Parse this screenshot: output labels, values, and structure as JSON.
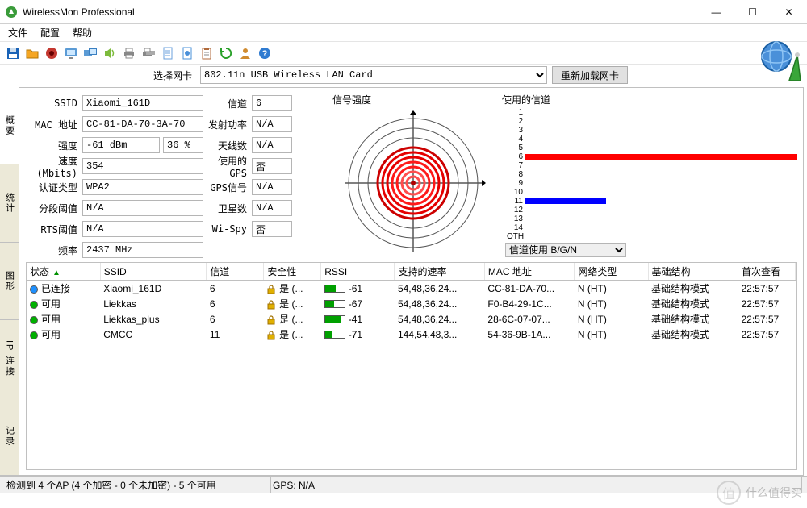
{
  "window": {
    "title": "WirelessMon Professional",
    "min": "—",
    "max": "☐",
    "close": "✕"
  },
  "menu": {
    "file": "文件",
    "config": "配置",
    "help": "帮助"
  },
  "selector": {
    "label": "选择网卡",
    "card": "802.11n USB Wireless LAN Card",
    "reload": "重新加载网卡"
  },
  "vtabs": [
    "概要",
    "统计",
    "图形",
    "IP 连接",
    "记录"
  ],
  "form": {
    "ssid_lbl": "SSID",
    "ssid": "Xiaomi_161D",
    "mac_lbl": "MAC 地址",
    "mac": "CC-81-DA-70-3A-70",
    "strength_lbl": "强度",
    "strength_dbm": "-61 dBm",
    "strength_pct": "36 %",
    "speed_lbl": "速度(Mbits)",
    "speed": "354",
    "auth_lbl": "认证类型",
    "auth": "WPA2",
    "frag_lbl": "分段阈值",
    "frag": "N/A",
    "rts_lbl": "RTS阈值",
    "rts": "N/A",
    "freq_lbl": "频率",
    "freq": "2437 MHz",
    "chan_lbl": "信道",
    "chan": "6",
    "txp_lbl": "发射功率",
    "txp": "N/A",
    "ant_lbl": "天线数",
    "ant": "N/A",
    "gps_lbl": "使用的GPS",
    "gps": "否",
    "gpssig_lbl": "GPS信号",
    "gpssig": "N/A",
    "sat_lbl": "卫星数",
    "sat": "N/A",
    "wispy_lbl": "Wi-Spy",
    "wispy": "否"
  },
  "radar": {
    "hdr": "信号强度"
  },
  "chan": {
    "hdr": "使用的信道",
    "rows": [
      "1",
      "2",
      "3",
      "4",
      "5",
      "6",
      "7",
      "8",
      "9",
      "10",
      "11",
      "12",
      "13",
      "14",
      "OTH"
    ],
    "bars": {
      "6": {
        "w": 100,
        "color": "#ff0000"
      },
      "11": {
        "w": 30,
        "color": "#0000ff"
      }
    },
    "select_label": "信道使用 B/G/N"
  },
  "list": {
    "cols": [
      "状态",
      "SSID",
      "信道",
      "安全性",
      "RSSI",
      "支持的速率",
      "MAC 地址",
      "网络类型",
      "基础结构",
      "首次查看"
    ],
    "rows": [
      {
        "status": "已连接",
        "color": "#1e90ff",
        "ssid": "Xiaomi_161D",
        "chan": "6",
        "sec": "是 (...",
        "rssi": "-61",
        "rpct": 55,
        "rates": "54,48,36,24...",
        "mac": "CC-81-DA-70...",
        "ntype": "N (HT)",
        "infra": "基础结构模式",
        "first": "22:57:57"
      },
      {
        "status": "可用",
        "color": "#00b000",
        "ssid": "Liekkas",
        "chan": "6",
        "sec": "是 (...",
        "rssi": "-67",
        "rpct": 45,
        "rates": "54,48,36,24...",
        "mac": "F0-B4-29-1C...",
        "ntype": "N (HT)",
        "infra": "基础结构模式",
        "first": "22:57:57"
      },
      {
        "status": "可用",
        "color": "#00b000",
        "ssid": "Liekkas_plus",
        "chan": "6",
        "sec": "是 (...",
        "rssi": "-41",
        "rpct": 80,
        "rates": "54,48,36,24...",
        "mac": "28-6C-07-07...",
        "ntype": "N (HT)",
        "infra": "基础结构模式",
        "first": "22:57:57"
      },
      {
        "status": "可用",
        "color": "#00b000",
        "ssid": "CMCC",
        "chan": "11",
        "sec": "是 (...",
        "rssi": "-71",
        "rpct": 35,
        "rates": "144,54,48,3...",
        "mac": "54-36-9B-1A...",
        "ntype": "N (HT)",
        "infra": "基础结构模式",
        "first": "22:57:57"
      }
    ]
  },
  "status": {
    "detect": "检测到 4 个AP (4 个加密 - 0 个未加密) - 5 个可用",
    "gps": "GPS: N/A"
  },
  "watermark": {
    "char": "值",
    "text": "什么值得买"
  },
  "toolbar_icons": [
    {
      "name": "save-icon",
      "color": "#1a63b7",
      "shape": "floppy"
    },
    {
      "name": "folder-icon",
      "color": "#f5a623",
      "shape": "folder"
    },
    {
      "name": "record-icon",
      "color": "#c4372f",
      "shape": "disc"
    },
    {
      "name": "desktop-icon",
      "color": "#5b9bd5",
      "shape": "monitor"
    },
    {
      "name": "multimonitor-icon",
      "color": "#5b9bd5",
      "shape": "monitors"
    },
    {
      "name": "sound-icon",
      "color": "#7dbb3c",
      "shape": "speaker"
    },
    {
      "name": "print-icon",
      "color": "#888",
      "shape": "printer"
    },
    {
      "name": "printers-icon",
      "color": "#888",
      "shape": "printer2"
    },
    {
      "name": "report-icon",
      "color": "#6ba0dc",
      "shape": "doc"
    },
    {
      "name": "script-icon",
      "color": "#4a90d9",
      "shape": "doc2"
    },
    {
      "name": "clipboard-icon",
      "color": "#b06a3b",
      "shape": "clipboard"
    },
    {
      "name": "refresh-icon",
      "color": "#2aa12a",
      "shape": "refresh"
    },
    {
      "name": "person-icon",
      "color": "#d08b2f",
      "shape": "person"
    },
    {
      "name": "help-icon",
      "color": "#2f7bd1",
      "shape": "help"
    }
  ]
}
